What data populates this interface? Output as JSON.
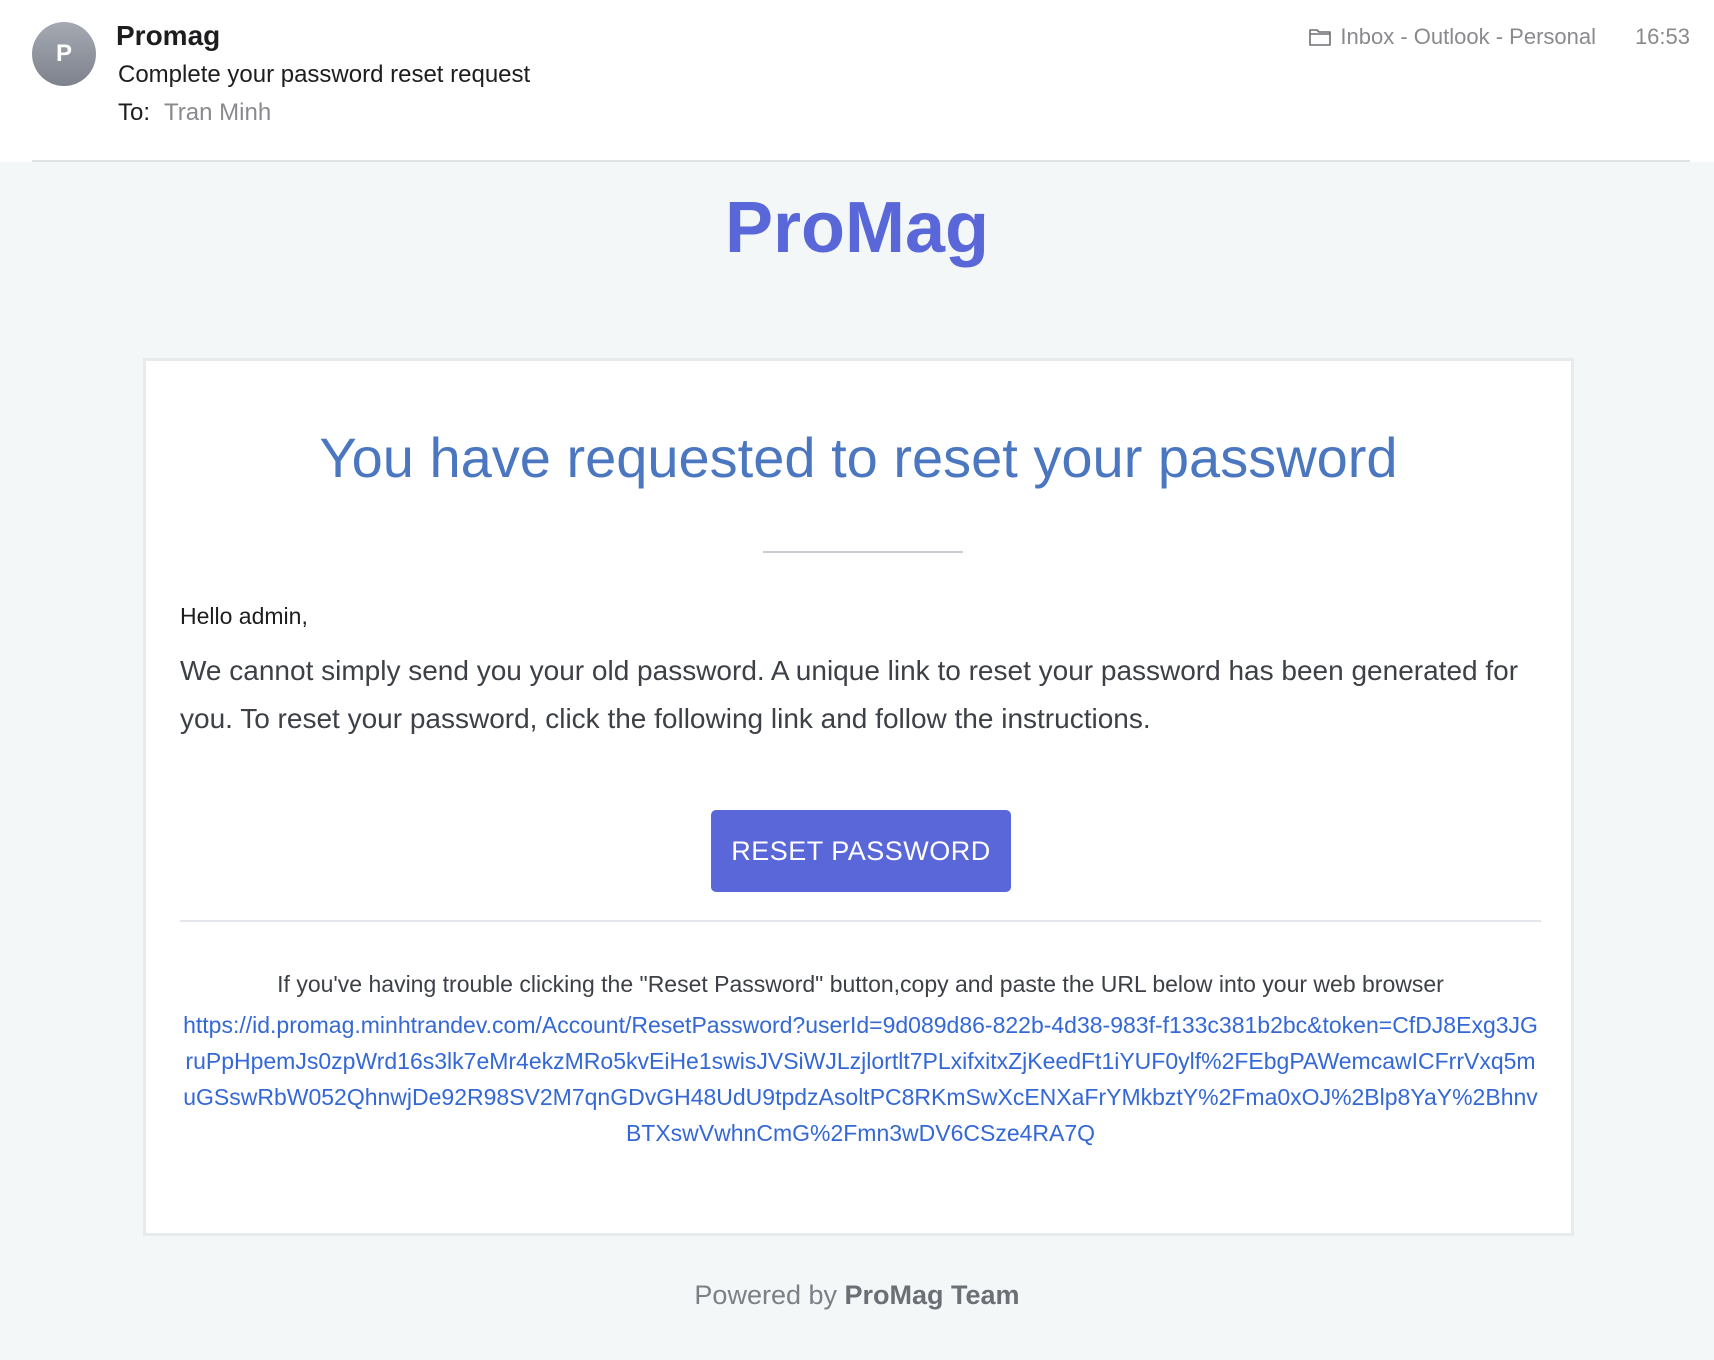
{
  "header": {
    "avatar_letter": "P",
    "sender": "Promag",
    "subject": "Complete your password reset request",
    "to_label": "To:",
    "to_name": "Tran Minh",
    "folder_icon": "folder-icon",
    "folder": "Inbox - Outlook - Personal",
    "time": "16:53"
  },
  "email": {
    "brand": "ProMag",
    "title": "You have requested to reset your password",
    "greeting": "Hello admin,",
    "paragraph": "We cannot simply send you your old password. A unique link to reset your password has been generated for you. To reset your password, click the following link and follow the instructions.",
    "button_label": "RESET PASSWORD",
    "trouble_text": "If you've having trouble clicking the \"Reset Password\" button,copy and paste the URL below into your web browser",
    "reset_url": "https://id.promag.minhtrandev.com/Account/ResetPassword?userId=9d089d86-822b-4d38-983f-f133c381b2bc&token=CfDJ8Exg3JGruPpHpemJs0zpWrd16s3lk7eMr4ekzMRo5kvEiHe1swisJVSiWJLzjlortlt7PLxifxitxZjKeedFt1iYUF0ylf%2FEbgPAWemcawICFrrVxq5muGSswRbW052QhnwjDe92R98SV2M7qnGDvGH48UdU9tpdzAsoltPC8RKmSwXcENXaFrYMkbztY%2Fma0xOJ%2Blp8YaY%2BhnvBTXswVwhnCmG%2Fmn3wDV6CSze4RA7Q",
    "footer_prefix": "Powered by ",
    "footer_team": "ProMag Team"
  },
  "colors": {
    "brand": "#5a67d8",
    "title": "#4a77bf",
    "link": "#3468d6",
    "body_bg": "#f3f7f7"
  }
}
